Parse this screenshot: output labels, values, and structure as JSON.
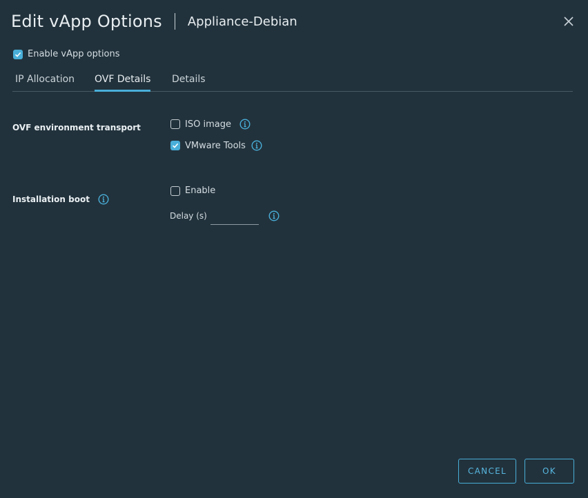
{
  "dialog": {
    "title": "Edit vApp Options",
    "subtitle": "Appliance-Debian",
    "close_icon": "close-icon"
  },
  "enable_vapp": {
    "label": "Enable vApp options",
    "checked": true
  },
  "tabs": [
    {
      "label": "IP Allocation",
      "active": false
    },
    {
      "label": "OVF Details",
      "active": true
    },
    {
      "label": "Details",
      "active": false
    }
  ],
  "ovf_transport": {
    "label": "OVF environment transport",
    "options": [
      {
        "label": "ISO image",
        "checked": false,
        "icon": "info-icon"
      },
      {
        "label": "VMware Tools",
        "checked": true,
        "icon": "info-icon"
      }
    ]
  },
  "installation_boot": {
    "label": "Installation boot",
    "icon": "info-icon",
    "enable": {
      "label": "Enable",
      "checked": false
    },
    "delay": {
      "label": "Delay (s)",
      "value": "",
      "icon": "info-icon"
    }
  },
  "footer": {
    "cancel_label": "CANCEL",
    "ok_label": "OK"
  },
  "colors": {
    "background": "#22323c",
    "accent": "#49afd9",
    "text": "#dfe6ea"
  }
}
